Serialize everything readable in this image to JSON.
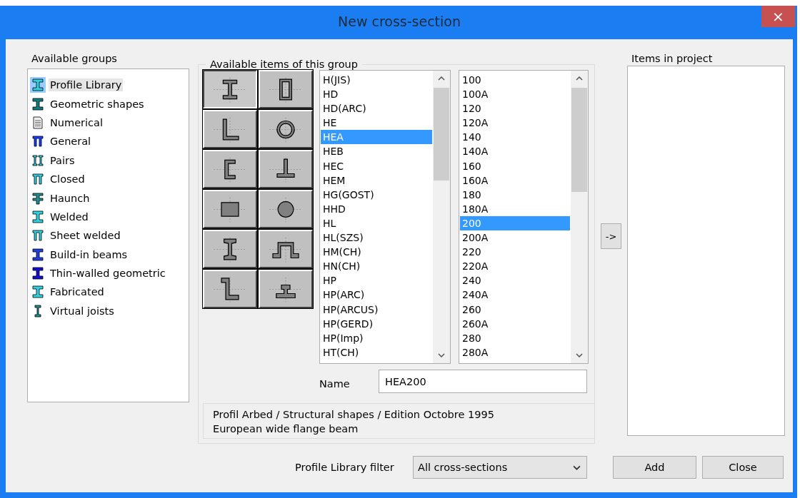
{
  "window": {
    "title": "New cross-section",
    "close": "×"
  },
  "groups": {
    "label": "Available groups",
    "items": [
      {
        "label": "Profile Library",
        "kind": "beam",
        "selected": true
      },
      {
        "label": "Geometric shapes",
        "kind": "solid-beam",
        "selected": false
      },
      {
        "label": "Numerical",
        "kind": "document",
        "selected": false
      },
      {
        "label": "General",
        "kind": "general",
        "selected": false
      },
      {
        "label": "Pairs",
        "kind": "pairs",
        "selected": false
      },
      {
        "label": "Closed",
        "kind": "closed",
        "selected": false
      },
      {
        "label": "Haunch",
        "kind": "haunch",
        "selected": false
      },
      {
        "label": "Welded",
        "kind": "welded",
        "selected": false
      },
      {
        "label": "Sheet welded",
        "kind": "sheet",
        "selected": false
      },
      {
        "label": "Build-in beams",
        "kind": "build-in",
        "selected": false
      },
      {
        "label": "Thin-walled geometric",
        "kind": "thin-walled",
        "selected": false
      },
      {
        "label": "Fabricated",
        "kind": "fabricated",
        "selected": false
      },
      {
        "label": "Virtual joists",
        "kind": "joist",
        "selected": false
      }
    ]
  },
  "items_group": {
    "label": "Available items of this group",
    "shapes": [
      {
        "kind": "i-beam",
        "selected": true
      },
      {
        "kind": "box",
        "selected": false
      },
      {
        "kind": "angle",
        "selected": false
      },
      {
        "kind": "tube",
        "selected": false
      },
      {
        "kind": "channel",
        "selected": false
      },
      {
        "kind": "tee",
        "selected": false
      },
      {
        "kind": "rectangle",
        "selected": false
      },
      {
        "kind": "round-bar",
        "selected": false
      },
      {
        "kind": "tapered-i-beam",
        "selected": false
      },
      {
        "kind": "omega",
        "selected": false
      },
      {
        "kind": "z-section",
        "selected": false
      },
      {
        "kind": "rail",
        "selected": false
      }
    ],
    "series": [
      {
        "label": "H(JIS)",
        "selected": false
      },
      {
        "label": "HD",
        "selected": false
      },
      {
        "label": "HD(ARC)",
        "selected": false
      },
      {
        "label": "HE",
        "selected": false
      },
      {
        "label": "HEA",
        "selected": true
      },
      {
        "label": "HEB",
        "selected": false
      },
      {
        "label": "HEC",
        "selected": false
      },
      {
        "label": "HEM",
        "selected": false
      },
      {
        "label": "HG(GOST)",
        "selected": false
      },
      {
        "label": "HHD",
        "selected": false
      },
      {
        "label": "HL",
        "selected": false
      },
      {
        "label": "HL(SZS)",
        "selected": false
      },
      {
        "label": "HM(CH)",
        "selected": false
      },
      {
        "label": "HN(CH)",
        "selected": false
      },
      {
        "label": "HP",
        "selected": false
      },
      {
        "label": "HP(ARC)",
        "selected": false
      },
      {
        "label": "HP(ARCUS)",
        "selected": false
      },
      {
        "label": "HP(GERD)",
        "selected": false
      },
      {
        "label": "HP(Imp)",
        "selected": false
      },
      {
        "label": "HT(CH)",
        "selected": false
      }
    ],
    "sizes": [
      {
        "label": "100",
        "selected": false
      },
      {
        "label": "100A",
        "selected": false
      },
      {
        "label": "120",
        "selected": false
      },
      {
        "label": "120A",
        "selected": false
      },
      {
        "label": "140",
        "selected": false
      },
      {
        "label": "140A",
        "selected": false
      },
      {
        "label": "160",
        "selected": false
      },
      {
        "label": "160A",
        "selected": false
      },
      {
        "label": "180",
        "selected": false
      },
      {
        "label": "180A",
        "selected": false
      },
      {
        "label": "200",
        "selected": true
      },
      {
        "label": "200A",
        "selected": false
      },
      {
        "label": "220",
        "selected": false
      },
      {
        "label": "220A",
        "selected": false
      },
      {
        "label": "240",
        "selected": false
      },
      {
        "label": "240A",
        "selected": false
      },
      {
        "label": "260",
        "selected": false
      },
      {
        "label": "260A",
        "selected": false
      },
      {
        "label": "280",
        "selected": false
      },
      {
        "label": "280A",
        "selected": false
      }
    ],
    "name": {
      "label": "Name",
      "value": "HEA200"
    },
    "description": [
      "Profil Arbed / Structural shapes / Edition Octobre 1995",
      "European wide flange beam"
    ]
  },
  "add_arrow": "->",
  "project": {
    "label": "Items in project"
  },
  "filter": {
    "label": "Profile Library filter",
    "value": "All cross-sections"
  },
  "buttons": [
    {
      "label": "Add"
    },
    {
      "label": "Close"
    }
  ]
}
